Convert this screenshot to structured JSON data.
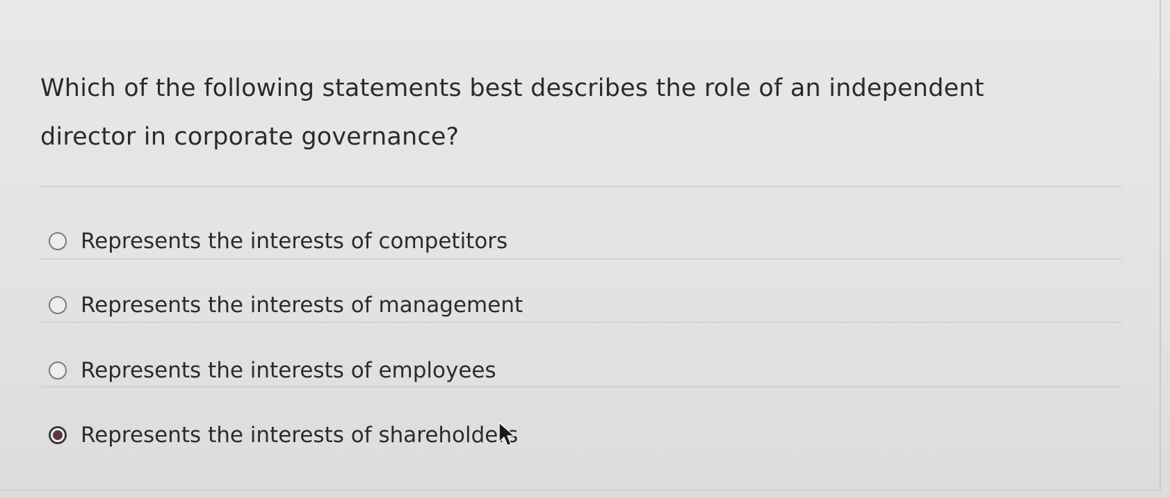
{
  "question": {
    "text": "Which of the following statements best describes the role of an independent director in corporate governance?"
  },
  "options": [
    {
      "label": "Represents the interests of competitors",
      "selected": false
    },
    {
      "label": "Represents the interests of management",
      "selected": false
    },
    {
      "label": "Represents the interests of employees",
      "selected": false
    },
    {
      "label": "Represents the interests of shareholders",
      "selected": true
    }
  ],
  "icons": {
    "radio_unselected": "radio-empty-icon",
    "radio_selected": "radio-filled-icon",
    "cursor": "mouse-pointer-icon"
  },
  "colors": {
    "background": "#e4e4e2",
    "text": "#2b2b2b",
    "divider": "#c4c4c2",
    "selected_dot": "#5a3848"
  }
}
